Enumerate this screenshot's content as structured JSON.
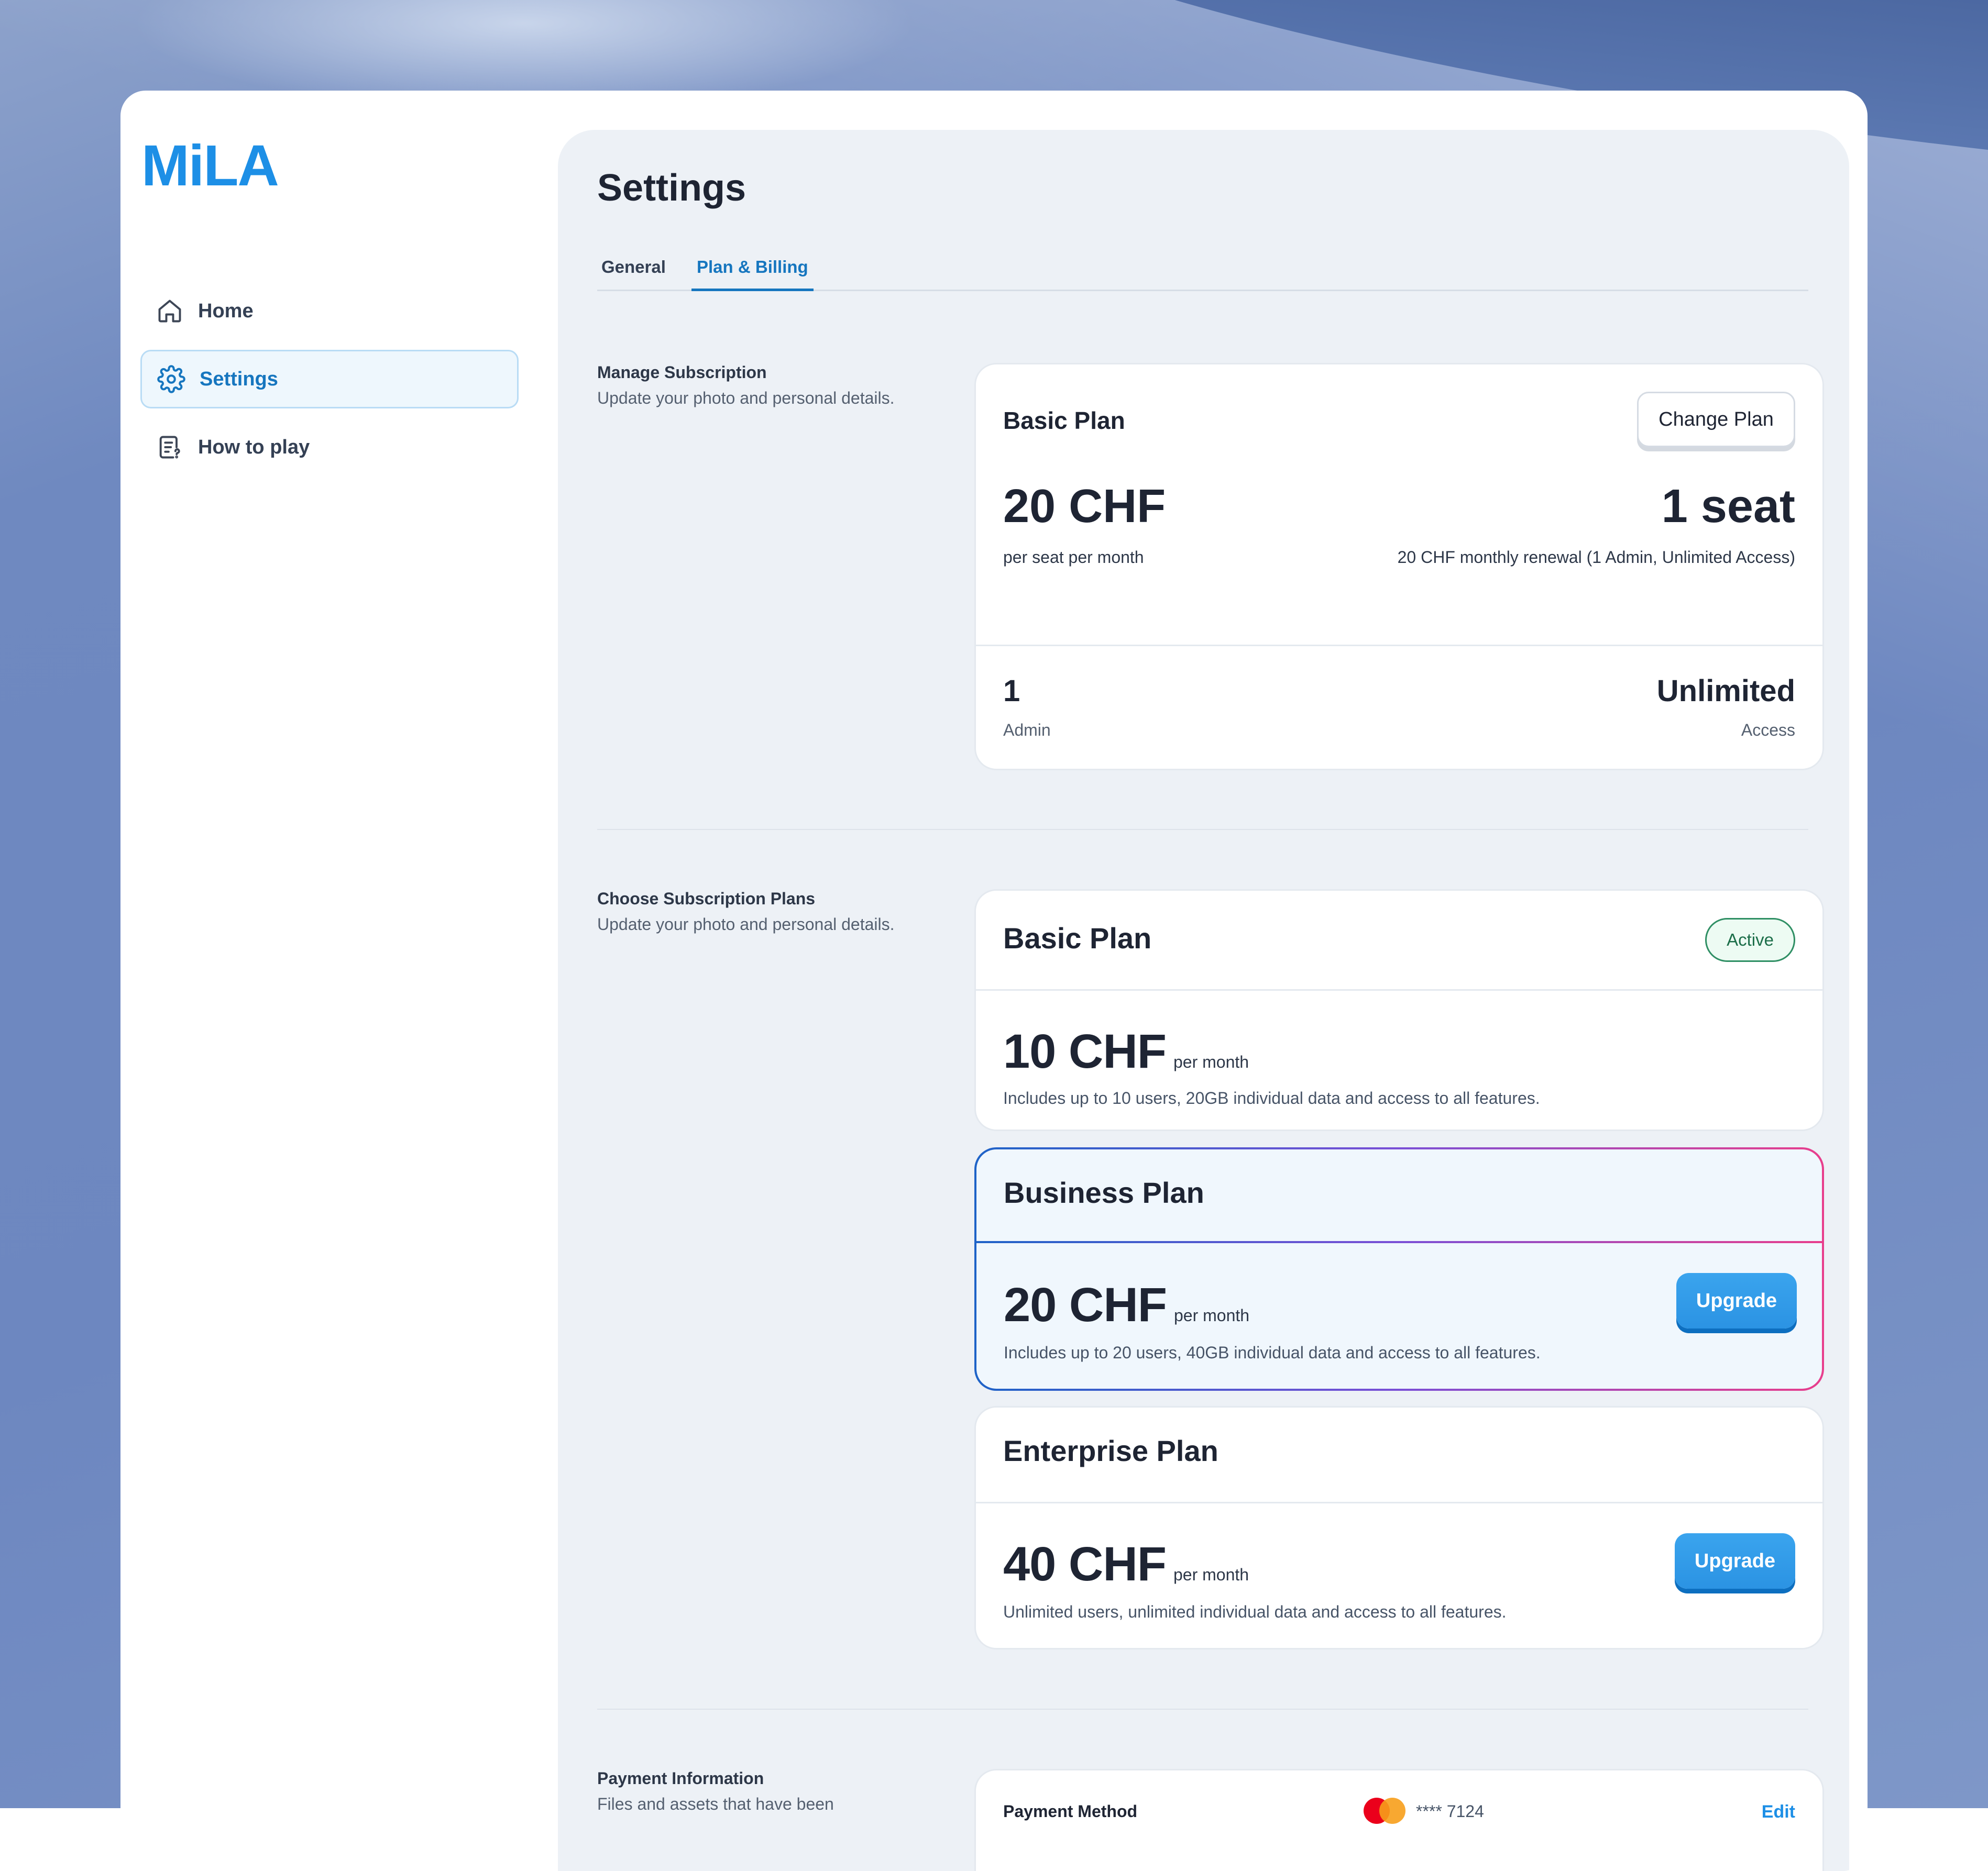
{
  "app": {
    "logo": "MiLA"
  },
  "sidebar": {
    "items": [
      {
        "label": "Home",
        "icon": "home-icon",
        "active": false
      },
      {
        "label": "Settings",
        "icon": "gear-icon",
        "active": true
      },
      {
        "label": "How to play",
        "icon": "document-help-icon",
        "active": false
      }
    ]
  },
  "page": {
    "title": "Settings",
    "tabs": [
      {
        "label": "General",
        "active": false
      },
      {
        "label": "Plan & Billing",
        "active": true
      }
    ]
  },
  "manage": {
    "title": "Manage Subscription",
    "subtitle": "Update your photo and personal details.",
    "plan_name": "Basic Plan",
    "change_button": "Change Plan",
    "price": "20 CHF",
    "price_caption": "per seat per month",
    "seats": "1 seat",
    "seats_caption": "20 CHF monthly renewal (1 Admin, Unlimited Access)",
    "admin_value": "1",
    "admin_label": "Admin",
    "access_value": "Unlimited",
    "access_label": "Access"
  },
  "plans": {
    "title": "Choose Subscription Plans",
    "subtitle": "Update your photo and personal details.",
    "items": [
      {
        "name": "Basic Plan",
        "price": "10 CHF",
        "per": "per month",
        "description": "Includes up to 10 users, 20GB individual data and access to all features.",
        "badge": "Active"
      },
      {
        "name": "Business Plan",
        "price": "20 CHF",
        "per": "per month",
        "description": "Includes up to 20 users, 40GB individual data and access to all features.",
        "button": "Upgrade"
      },
      {
        "name": "Enterprise Plan",
        "price": "40 CHF",
        "per": "per month",
        "description": "Unlimited users, unlimited individual data and access to all features.",
        "button": "Upgrade"
      }
    ]
  },
  "payment": {
    "title": "Payment Information",
    "subtitle": "Files and assets that have been",
    "method_label": "Payment Method",
    "card_masked": "**** 7124",
    "edit_label": "Edit"
  },
  "colors": {
    "accent": "#1d8fe6",
    "active_badge": "#2f8f64",
    "highlight_border_start": "#1e63c7",
    "highlight_border_end": "#e83e8c"
  }
}
